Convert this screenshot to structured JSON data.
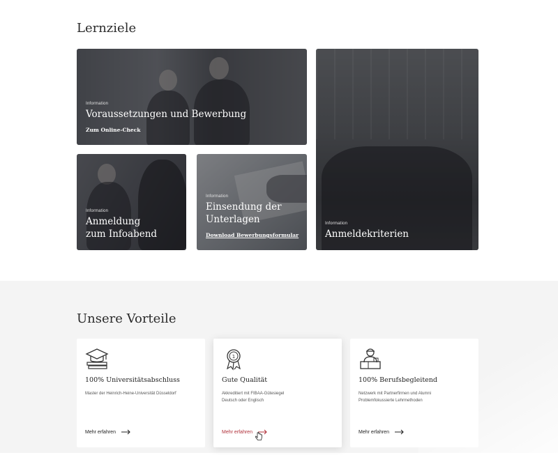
{
  "section1": {
    "title": "Lernziele",
    "tiles": [
      {
        "kicker": "Information",
        "title": "Voraussetzungen und Bewerbung",
        "link": "Zum Online-Check"
      },
      {
        "kicker": "Information",
        "title_line1": "Anmeldung",
        "title_line2": "zum Infoabend"
      },
      {
        "kicker": "Information",
        "title_line1": "Einsendung der",
        "title_line2": "Unterlagen",
        "link": "Download Bewerbungsformular"
      },
      {
        "kicker": "Information",
        "title": "Anmeldekriterien"
      }
    ]
  },
  "section2": {
    "title": "Unsere Vorteile",
    "cards": [
      {
        "icon": "graduation-cap-icon",
        "title": "100% Universitätsabschluss",
        "desc_line1": "Master der Heinrich-Heine-Universität Düsseldorf",
        "desc_line2": "",
        "more": "Mehr erfahren"
      },
      {
        "icon": "award-medal-icon",
        "title": "Gute Qualität",
        "desc_line1": "Akkreditiert mit FIBAA-Gütesiegel",
        "desc_line2": "Deutsch oder Englisch",
        "more": "Mehr erfahren"
      },
      {
        "icon": "professional-desk-icon",
        "title": "100% Berufsbegleitend",
        "desc_line1": "Netzwerk mit Partnerfirmen und Alumni",
        "desc_line2": "Problemfokussierte Lehrmethoden",
        "more": "Mehr erfahren"
      }
    ]
  },
  "colors": {
    "accent": "#b0303a",
    "band": "#f4f4f4"
  }
}
